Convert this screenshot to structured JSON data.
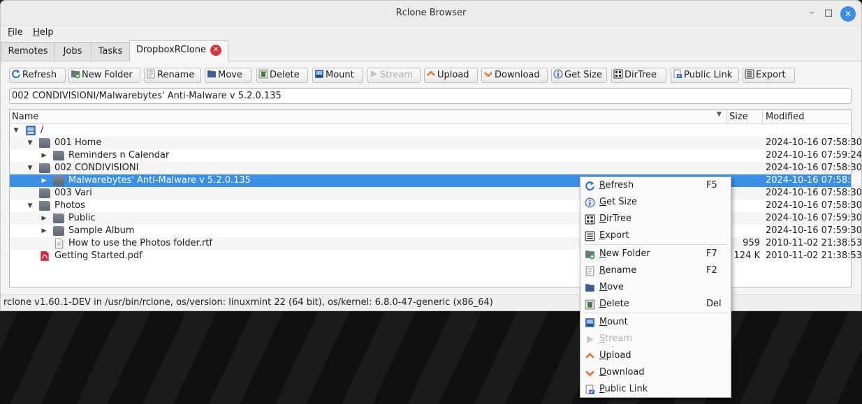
{
  "window": {
    "title": "Rclone Browser"
  },
  "menu": [
    {
      "label": "File"
    },
    {
      "label": "Help"
    }
  ],
  "tabs": [
    {
      "label": "Remotes"
    },
    {
      "label": "Jobs"
    },
    {
      "label": "Tasks"
    },
    {
      "label": "DropboxRClone"
    }
  ],
  "toolbar": [
    {
      "label": "Refresh",
      "icon": "refresh-icon"
    },
    {
      "label": "New Folder",
      "icon": "new-folder-icon"
    },
    {
      "label": "Rename",
      "icon": "rename-icon"
    },
    {
      "label": "Move",
      "icon": "move-icon"
    },
    {
      "label": "Delete",
      "icon": "delete-icon"
    },
    {
      "label": "Mount",
      "icon": "mount-icon"
    },
    {
      "label": "Stream",
      "icon": "stream-icon",
      "disabled": true
    },
    {
      "label": "Upload",
      "icon": "upload-icon"
    },
    {
      "label": "Download",
      "icon": "download-icon"
    },
    {
      "label": "Get Size",
      "icon": "info-icon"
    },
    {
      "label": "DirTree",
      "icon": "dirtree-icon"
    },
    {
      "label": "Public Link",
      "icon": "public-link-icon"
    },
    {
      "label": "Export",
      "icon": "export-icon"
    }
  ],
  "path": "002 CONDIVISIONI/Malwarebytes' Anti-Malware v 5.2.0.135",
  "columns": {
    "name": "Name",
    "size": "Size",
    "modified": "Modified"
  },
  "rows": [
    {
      "name": "/",
      "size": "",
      "modified": ""
    },
    {
      "name": "001 Home",
      "size": "",
      "modified": "2024-10-16 07:58:30"
    },
    {
      "name": "Reminders n Calendar",
      "size": "",
      "modified": "2024-10-16 07:59:24"
    },
    {
      "name": "002 CONDIVISIONI",
      "size": "",
      "modified": "2024-10-16 07:58:30"
    },
    {
      "name": "Malwarebytes' Anti-Malware v 5.2.0.135",
      "size": "",
      "modified": "2024-10-16 07:58:58"
    },
    {
      "name": "003 Vari",
      "size": "",
      "modified": "2024-10-16 07:58:30"
    },
    {
      "name": "Photos",
      "size": "",
      "modified": "2024-10-16 07:58:30"
    },
    {
      "name": "Public",
      "size": "",
      "modified": "2024-10-16 07:59:30"
    },
    {
      "name": "Sample Album",
      "size": "",
      "modified": "2024-10-16 07:59:30"
    },
    {
      "name": "How to use the Photos folder.rtf",
      "size": "959",
      "modified": "2010-11-02 21:38:53"
    },
    {
      "name": "Getting Started.pdf",
      "size": "124 K",
      "modified": "2010-11-02 21:38:53"
    }
  ],
  "status": "rclone v1.60.1-DEV in /usr/bin/rclone, os/version: linuxmint 22 (64 bit), os/kernel: 6.8.0-47-generic (x86_64)",
  "context_menu": [
    {
      "label": "Refresh",
      "shortcut": "F5",
      "icon": "refresh-icon"
    },
    {
      "label": "Get Size",
      "shortcut": "",
      "icon": "info-icon"
    },
    {
      "label": "DirTree",
      "shortcut": "",
      "icon": "dirtree-icon"
    },
    {
      "label": "Export",
      "shortcut": "",
      "icon": "export-icon"
    },
    {
      "label": "New Folder",
      "shortcut": "F7",
      "icon": "new-folder-icon"
    },
    {
      "label": "Rename",
      "shortcut": "F2",
      "icon": "rename-icon"
    },
    {
      "label": "Move",
      "shortcut": "",
      "icon": "move-icon"
    },
    {
      "label": "Delete",
      "shortcut": "Del",
      "icon": "delete-icon"
    },
    {
      "label": "Mount",
      "shortcut": "",
      "icon": "mount-icon"
    },
    {
      "label": "Stream",
      "shortcut": "",
      "icon": "stream-icon",
      "disabled": true
    },
    {
      "label": "Upload",
      "shortcut": "",
      "icon": "upload-icon"
    },
    {
      "label": "Download",
      "shortcut": "",
      "icon": "download-icon"
    },
    {
      "label": "Public Link",
      "shortcut": "",
      "icon": "public-link-icon"
    }
  ],
  "colors": {
    "selection": "#3a8ee6",
    "close_tab": "#d8353c",
    "accent_orange": "#e8702a"
  }
}
